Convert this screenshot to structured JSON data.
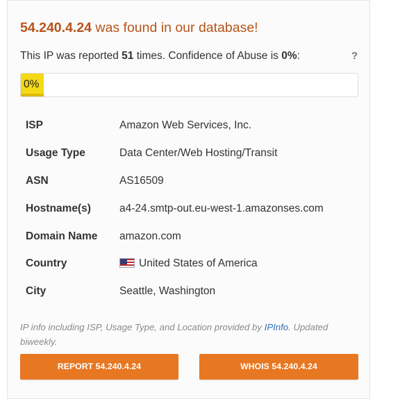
{
  "header": {
    "ip": "54.240.4.24",
    "title_suffix": " was found in our database!"
  },
  "report_summary": {
    "prefix": "This IP was reported ",
    "count": "51",
    "middle": " times. Confidence of Abuse is ",
    "confidence": "0%",
    "suffix": ":",
    "help": "?"
  },
  "confidence_bar": {
    "label": "0%",
    "percent": 0,
    "fill_color": "#f4d915"
  },
  "info_rows": [
    {
      "key": "ISP",
      "value": "Amazon Web Services, Inc."
    },
    {
      "key": "Usage Type",
      "value": "Data Center/Web Hosting/Transit"
    },
    {
      "key": "ASN",
      "value": "AS16509"
    },
    {
      "key": "Hostname(s)",
      "value": "a4-24.smtp-out.eu-west-1.amazonses.com"
    },
    {
      "key": "Domain Name",
      "value": "amazon.com"
    },
    {
      "key": "Country",
      "value": "United States of America",
      "icon": "us-flag-icon"
    },
    {
      "key": "City",
      "value": "Seattle, Washington"
    }
  ],
  "credit": {
    "before": "IP info including ISP, Usage Type, and Location provided by ",
    "link": "IPInfo",
    "after": ". Updated biweekly."
  },
  "buttons": {
    "report": "REPORT 54.240.4.24",
    "whois": "WHOIS 54.240.4.24"
  },
  "colors": {
    "title": "#b6541a",
    "button": "#e87722",
    "link": "#2a6fb7"
  }
}
